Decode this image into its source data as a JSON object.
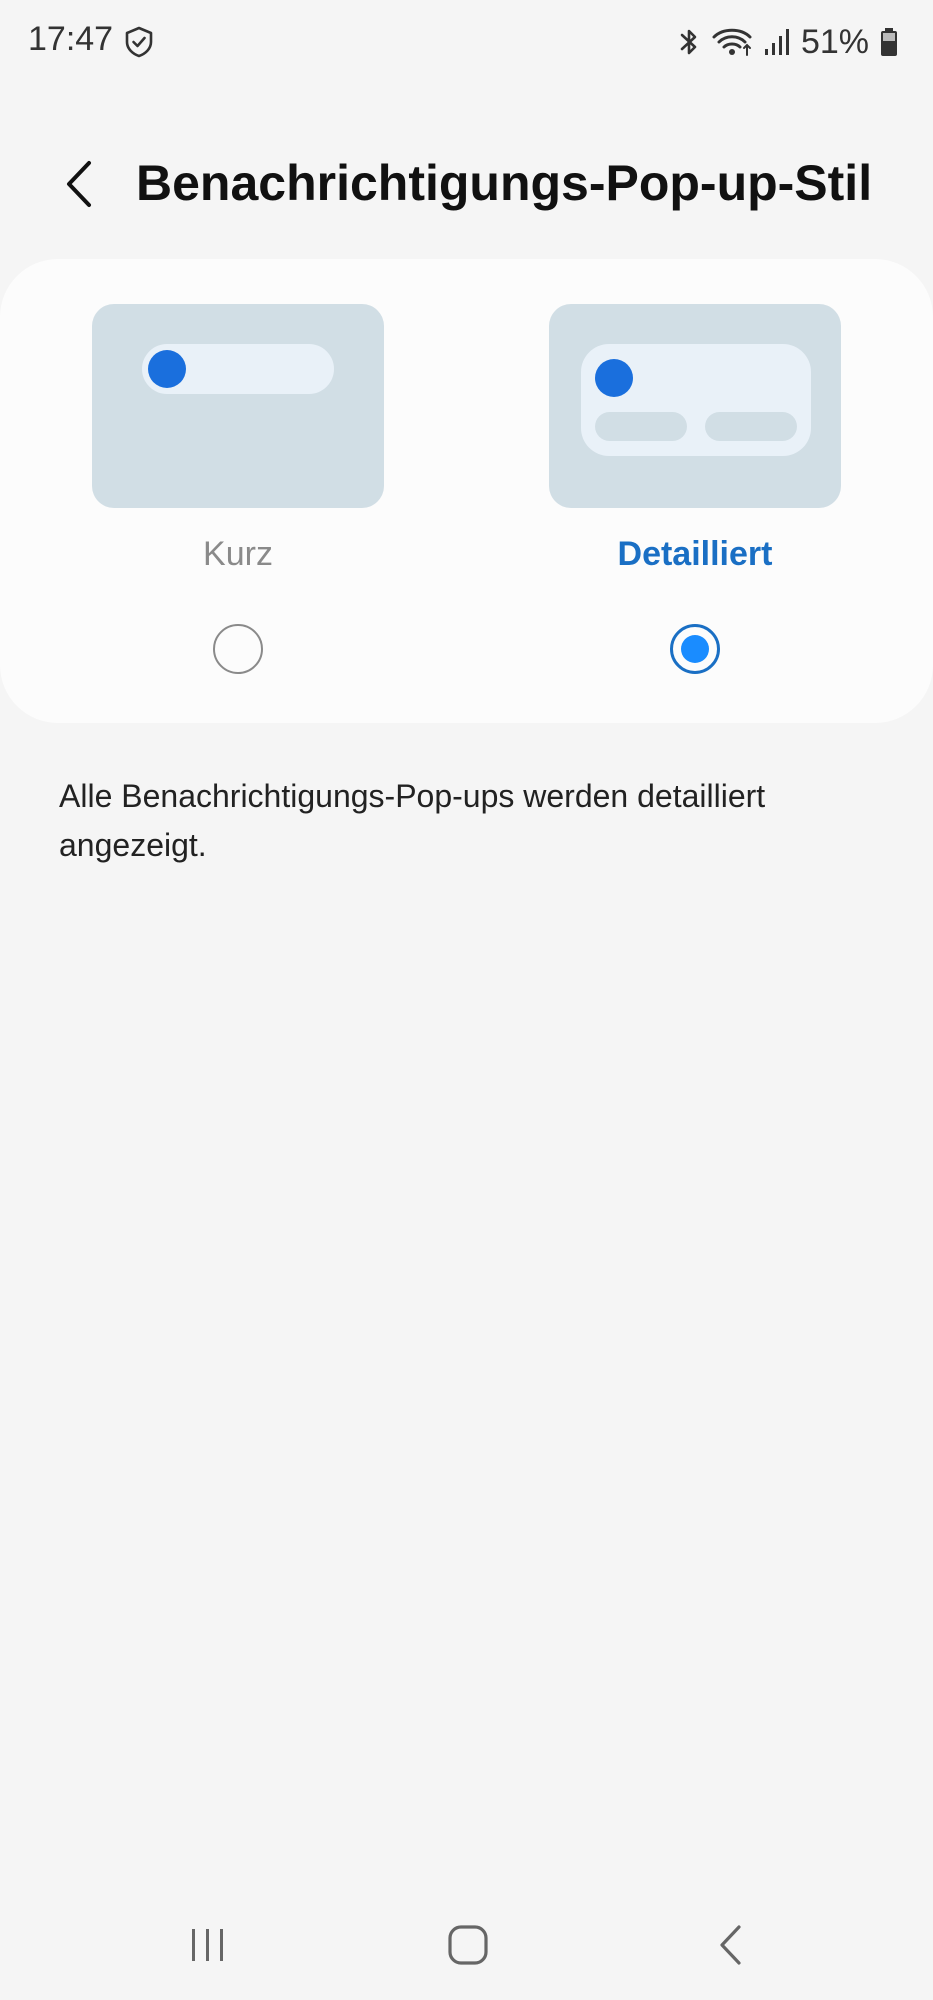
{
  "status_bar": {
    "time": "17:47",
    "battery_percent": "51%",
    "icons": [
      "shield-check-icon",
      "bluetooth-icon",
      "wifi-icon",
      "signal-icon",
      "battery-icon"
    ]
  },
  "header": {
    "title": "Benachrichtigungs-Pop-up-Stil",
    "back_icon": "chevron-left-icon"
  },
  "options": [
    {
      "label": "Kurz",
      "selected": false
    },
    {
      "label": "Detailliert",
      "selected": true
    }
  ],
  "description": "Alle Benachrichtigungs-Pop-ups werden detailliert angezeigt.",
  "nav_bar": {
    "buttons": [
      "recents-icon",
      "home-icon",
      "back-icon"
    ]
  },
  "colors": {
    "accent": "#1a6fc4",
    "radio_selected": "#1a8cff",
    "preview_bg": "#d1dee5",
    "preview_dot": "#1a6fdd",
    "background": "#f5f5f5",
    "card": "#fcfcfc"
  }
}
